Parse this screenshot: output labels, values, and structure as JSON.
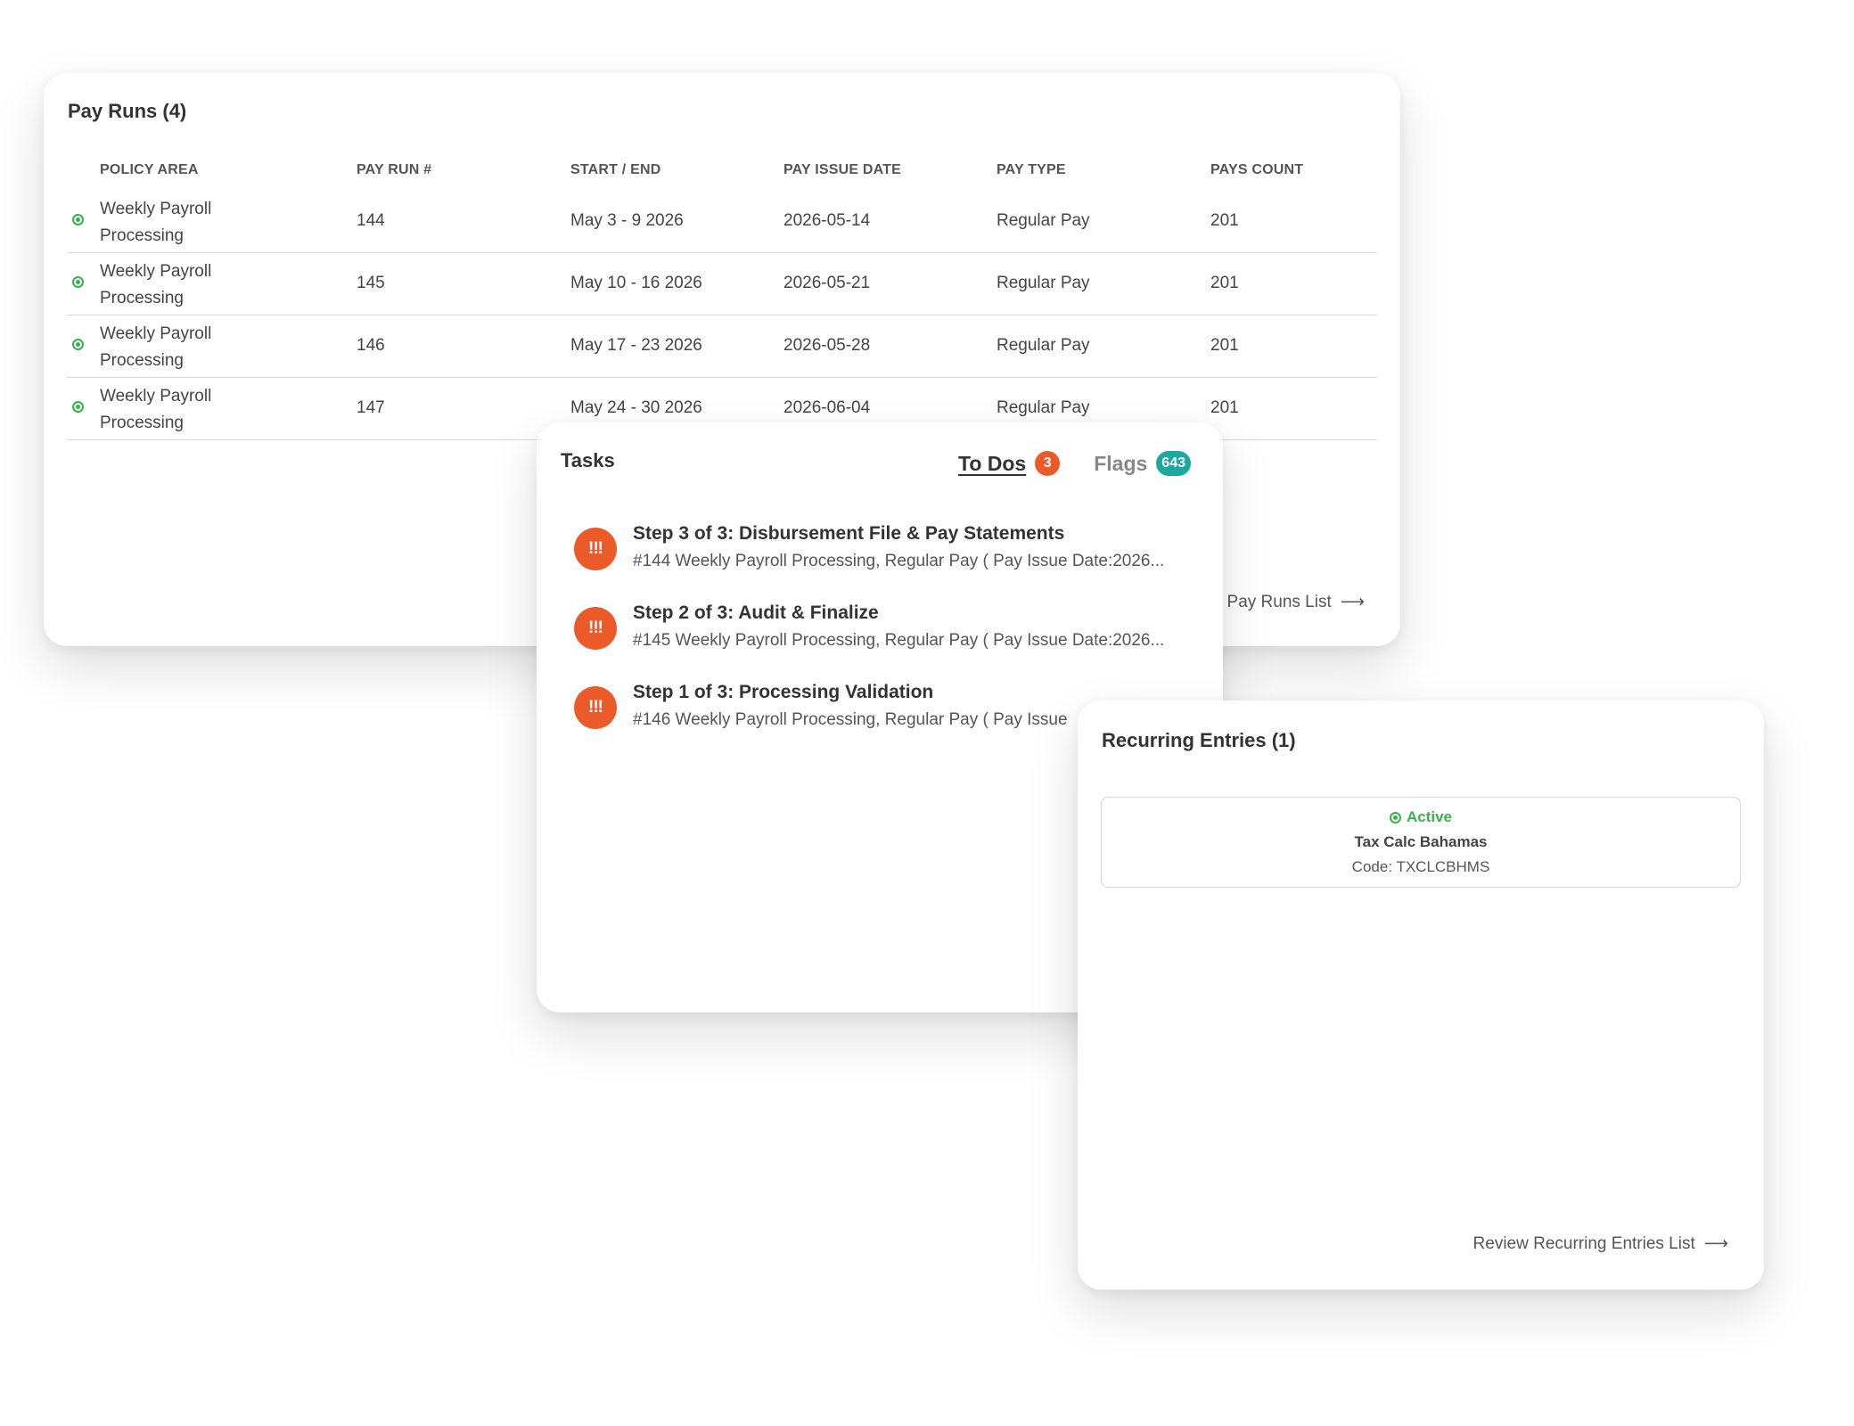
{
  "pay_runs": {
    "title": "Pay Runs (4)",
    "columns": [
      "POLICY AREA",
      "PAY RUN #",
      "START / END",
      "PAY ISSUE DATE",
      "PAY TYPE",
      "PAYS COUNT"
    ],
    "rows": [
      {
        "area": "Weekly Payroll Processing",
        "run": "144",
        "period": "May 3 - 9 2026",
        "issue_date": "2026-05-14",
        "type": "Regular Pay",
        "count": "201"
      },
      {
        "area": "Weekly Payroll Processing",
        "run": "145",
        "period": "May 10 - 16 2026",
        "issue_date": "2026-05-21",
        "type": "Regular Pay",
        "count": "201"
      },
      {
        "area": "Weekly Payroll Processing",
        "run": "146",
        "period": "May 17 - 23 2026",
        "issue_date": "2026-05-28",
        "type": "Regular Pay",
        "count": "201"
      },
      {
        "area": "Weekly Payroll Processing",
        "run": "147",
        "period": "May 24 - 30 2026",
        "issue_date": "2026-06-04",
        "type": "Regular Pay",
        "count": "201"
      }
    ],
    "view_link": "View Pay Runs List",
    "arrow": "⟶",
    "status_color": "#35b34a"
  },
  "tasks": {
    "title": "Tasks",
    "tabs": {
      "todos": {
        "label": "To Dos",
        "count": "3"
      },
      "flags": {
        "label": "Flags",
        "count": "643"
      }
    },
    "icon_glyph": "!!!",
    "items": [
      {
        "title": "Step 3 of 3: Disbursement File & Pay Statements",
        "subtitle": "#144 Weekly Payroll Processing, Regular Pay ( Pay Issue Date:2026..."
      },
      {
        "title": "Step 2 of 3: Audit & Finalize",
        "subtitle": "#145 Weekly Payroll Processing, Regular Pay ( Pay Issue Date:2026..."
      },
      {
        "title": "Step 1 of 3: Processing Validation",
        "subtitle": "#146 Weekly Payroll Processing, Regular Pay ( Pay Issue"
      }
    ],
    "accent_color": "#ec5a2a",
    "flags_color": "#1aa8a1"
  },
  "recurring": {
    "title": "Recurring Entries (1)",
    "entry": {
      "status": "Active",
      "name": "Tax Calc Bahamas",
      "code": "Code: TXCLCBHMS"
    },
    "review_link": "Review Recurring Entries List",
    "arrow": "⟶"
  }
}
